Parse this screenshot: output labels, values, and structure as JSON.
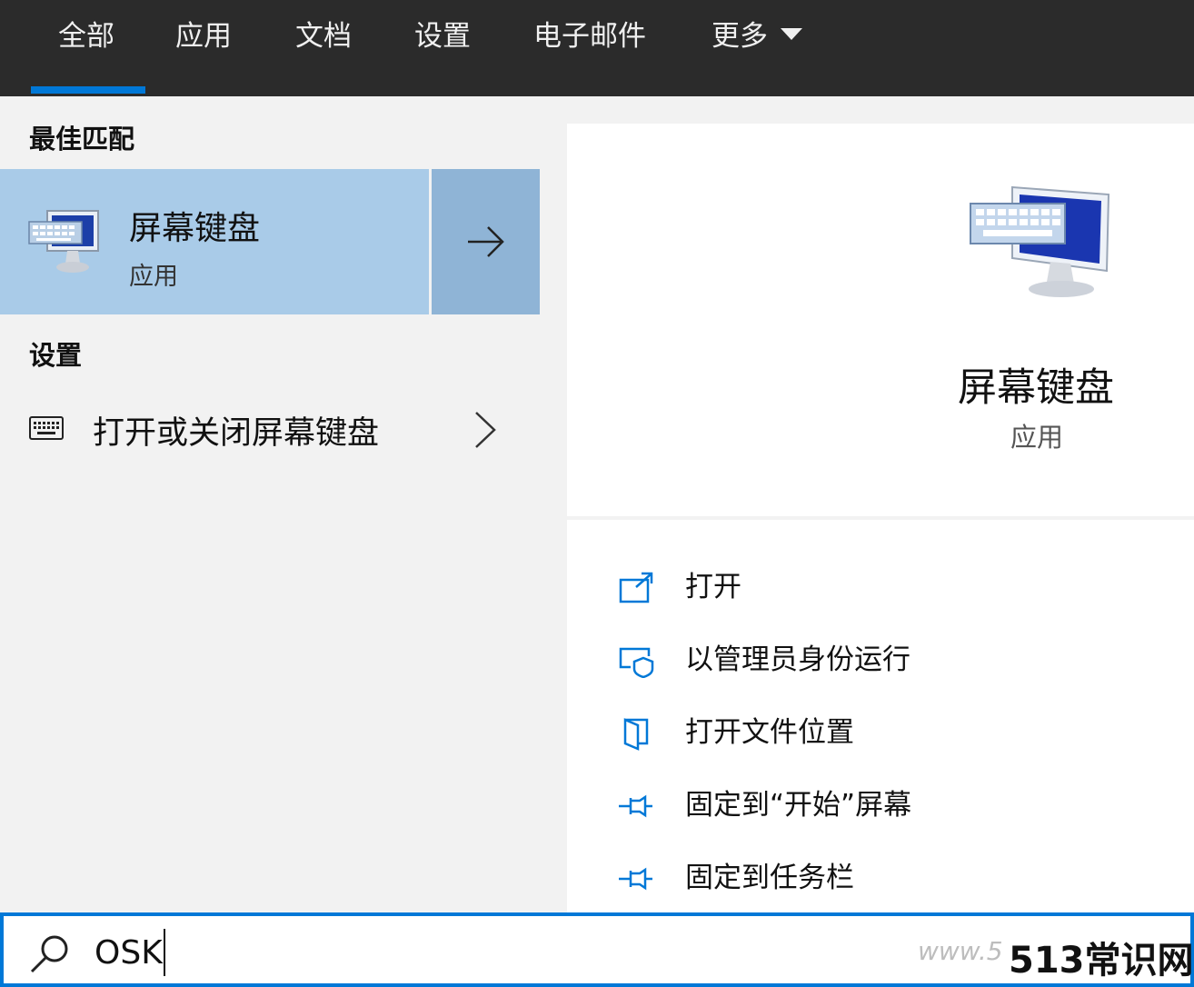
{
  "tabs": [
    {
      "label": "全部",
      "active": true
    },
    {
      "label": "应用",
      "active": false
    },
    {
      "label": "文档",
      "active": false
    },
    {
      "label": "设置",
      "active": false
    },
    {
      "label": "电子邮件",
      "active": false
    },
    {
      "label": "更多",
      "active": false
    }
  ],
  "left": {
    "best_match_heading": "最佳匹配",
    "best_match": {
      "title": "屏幕键盘",
      "subtitle": "应用"
    },
    "settings_heading": "设置",
    "settings_item": {
      "label": "打开或关闭屏幕键盘"
    }
  },
  "detail": {
    "title": "屏幕键盘",
    "subtitle": "应用",
    "actions": [
      {
        "label": "打开",
        "icon": "open-icon"
      },
      {
        "label": "以管理员身份运行",
        "icon": "admin-shield-icon"
      },
      {
        "label": "打开文件位置",
        "icon": "file-location-icon"
      },
      {
        "label": "固定到“开始”屏幕",
        "icon": "pin-icon"
      },
      {
        "label": "固定到任务栏",
        "icon": "pin-icon"
      }
    ]
  },
  "search": {
    "value": "OSK"
  },
  "watermark": {
    "text": "513常识网",
    "faint": "www.5"
  },
  "colors": {
    "accent": "#0078d7",
    "topbar": "#2b2b2b",
    "selected": "#a9cbe8",
    "selected_arrow": "#8fb4d6"
  }
}
